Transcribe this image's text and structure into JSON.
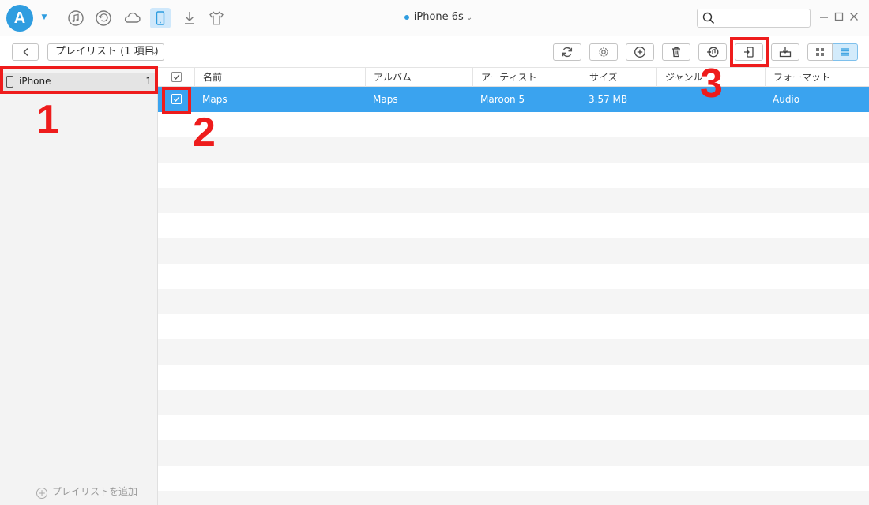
{
  "window": {
    "device_title": "iPhone 6s",
    "search": {
      "placeholder": ""
    }
  },
  "titlebar": {
    "logo_letter": "A",
    "nav_icons": [
      "music-icon",
      "restore-icon",
      "cloud-icon",
      "phone-icon",
      "download-icon",
      "tshirt-icon"
    ],
    "active_nav": "phone-icon"
  },
  "toolbar": {
    "playlist_select": "プレイリスト (1 項目)",
    "buttons": [
      "refresh-icon",
      "settings-icon",
      "add-icon",
      "delete-icon",
      "to-itunes-icon",
      "to-device-icon",
      "to-computer-icon"
    ],
    "views": [
      "grid-view-icon",
      "list-view-icon"
    ],
    "active_view": "list-view-icon"
  },
  "sidebar": {
    "items": [
      {
        "label": "iPhone",
        "count": "1"
      }
    ],
    "add_playlist": "プレイリストを追加"
  },
  "table": {
    "columns": [
      "名前",
      "アルバム",
      "アーティスト",
      "サイズ",
      "ジャンル",
      "フォーマット"
    ],
    "rows": [
      {
        "name": "Maps",
        "album": "Maps",
        "artist": "Maroon 5",
        "size": "3.57 MB",
        "genre": "",
        "format": "Audio",
        "checked": true
      }
    ]
  },
  "annotations": {
    "labels": [
      "1",
      "2",
      "3"
    ],
    "color": "#ee1c1c"
  },
  "colors": {
    "accent": "#3aa3ef",
    "selected_row": "#3aa3ef"
  }
}
